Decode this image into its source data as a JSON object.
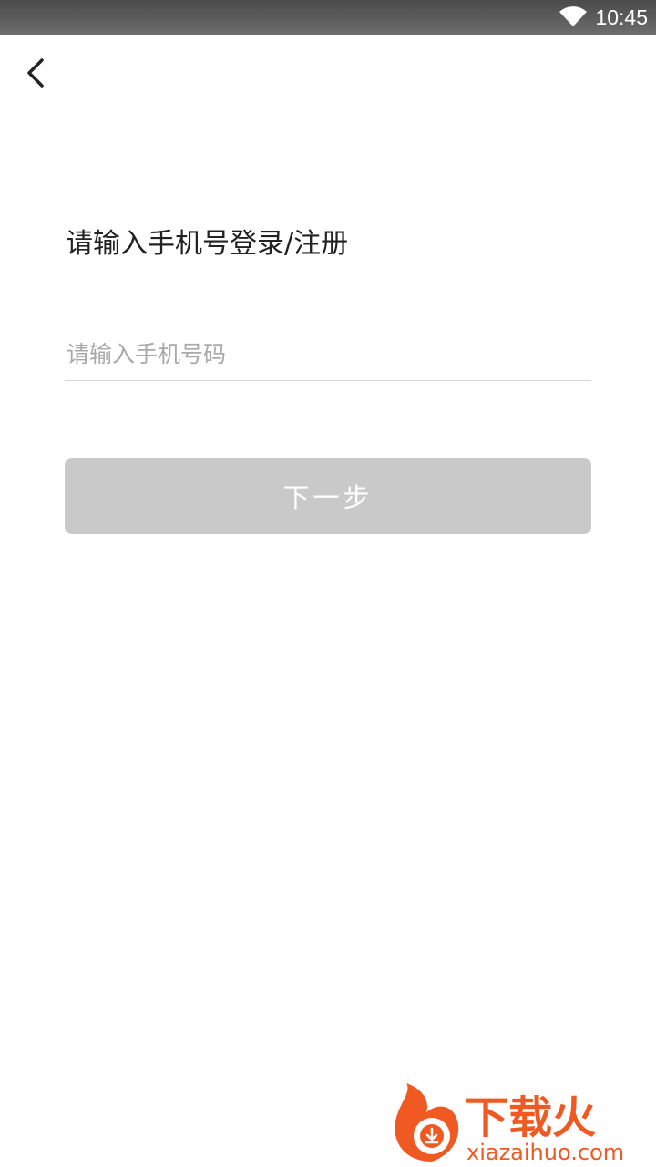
{
  "status_bar": {
    "time": "10:45",
    "wifi_icon": "wifi-icon"
  },
  "nav": {
    "back_icon": "chevron-left-icon"
  },
  "login": {
    "title": "请输入手机号登录/注册",
    "phone_placeholder": "请输入手机号码",
    "next_label": "下一步"
  },
  "watermark": {
    "logo_text": "下载火",
    "domain": "xiazaihuo.com"
  },
  "colors": {
    "button_disabled": "#c9c9c9",
    "watermark_orange": "#f05a22"
  }
}
